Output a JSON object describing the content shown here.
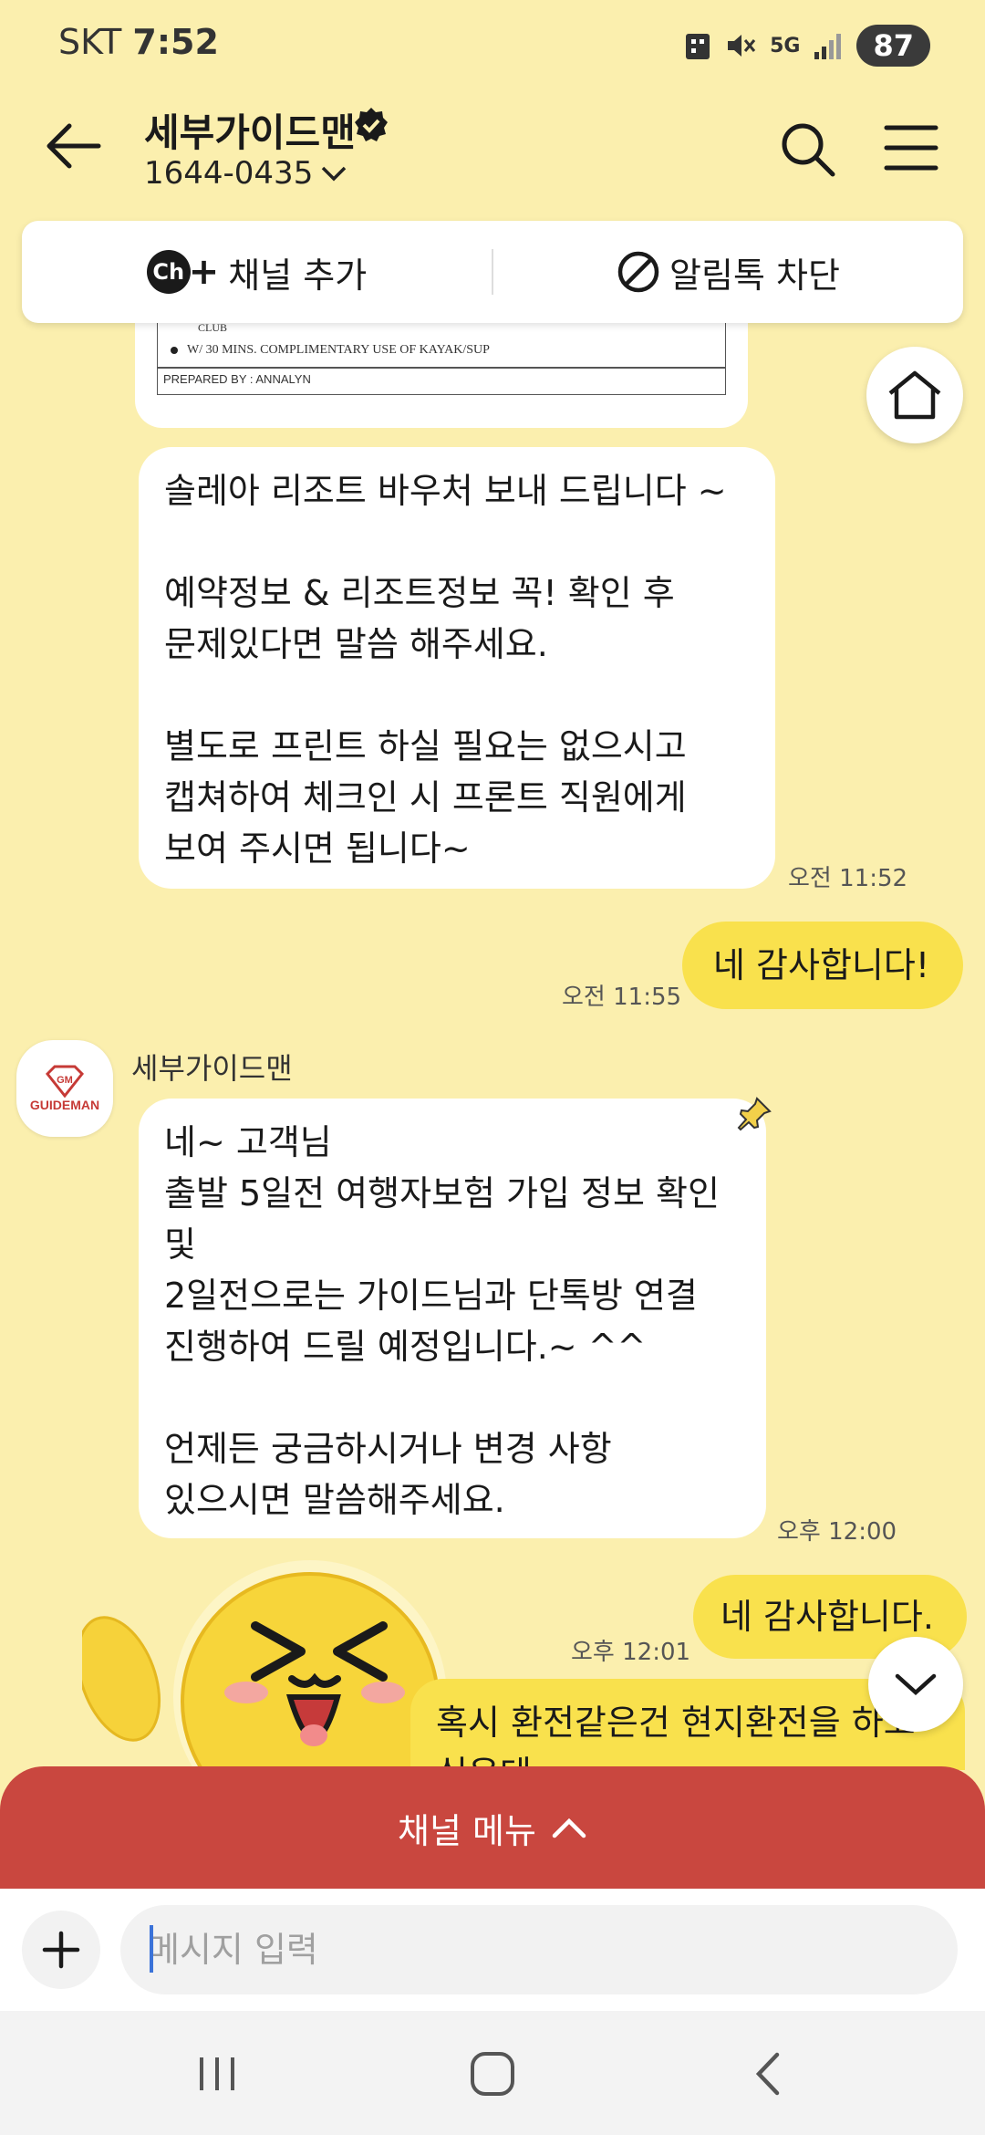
{
  "status_bar": {
    "carrier": "SKT",
    "time": "7:52",
    "network": "5G",
    "battery": "87"
  },
  "header": {
    "title": "세부가이드맨",
    "phone": "1644-0435"
  },
  "actions": {
    "add_channel": "채널 추가",
    "block_alimtalk": "알림톡 차단",
    "ch_badge": "Ch"
  },
  "voucher": {
    "line_club": "CLUB",
    "line_kayak": "W/ 30 MINS. COMPLIMENTARY USE OF KAYAK/SUP",
    "prepared_by": "PREPARED BY : ANNALYN"
  },
  "messages": [
    {
      "text": "솔레아 리조트 바우처 보내 드립니다 ~\n\n예약정보 & 리조트정보 꼭! 확인 후\n문제있다면 말씀 해주세요.\n\n별도로 프린트 하실 필요는 없으시고\n캡쳐하여 체크인 시 프론트 직원에게\n보여 주시면 됩니다~",
      "time": "오전 11:52"
    },
    {
      "text": "네 감사합니다!",
      "time": "오전 11:55"
    },
    {
      "sender": "세부가이드맨",
      "text": "네~ 고객님\n출발 5일전 여행자보험 가입 정보 확인\n및\n2일전으로는 가이드님과 단톡방 연결\n진행하여 드릴 예정입니다.~ ^^\n\n언제든 궁금하시거나 변경 사항\n있으시면 말씀해주세요.",
      "time": "오후 12:00"
    },
    {
      "text": "네 감사합니다.",
      "time": "오후 12:01"
    },
    {
      "text": "혹시 환전같은건 현지환전을 하고\n싶은데"
    }
  ],
  "avatar": {
    "brand": "GUIDEMAN"
  },
  "channel_menu": {
    "label": "채널 메뉴"
  },
  "input": {
    "placeholder": "메시지 입력"
  }
}
